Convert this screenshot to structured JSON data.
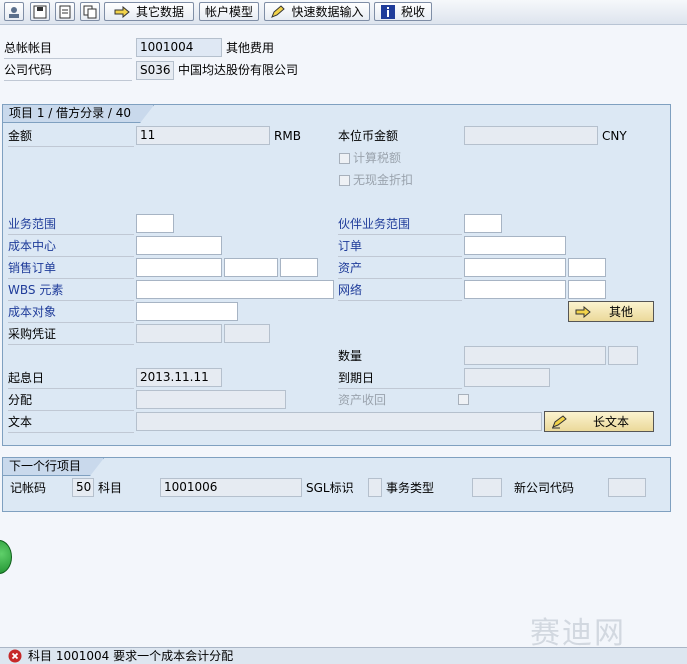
{
  "toolbar": {
    "other_data": "其它数据",
    "account_model": "帐户模型",
    "fast_entry": "快速数据输入",
    "tax": "税收"
  },
  "header": {
    "gl_account_label": "总帐帐目",
    "gl_account_value": "1001004",
    "gl_account_desc": "其他费用",
    "company_code_label": "公司代码",
    "company_code_value": "S036",
    "company_name": "中国均达股份有限公司"
  },
  "item": {
    "title": "项目 1 / 借方分录 / 40",
    "amount_label": "金额",
    "amount_value": "11",
    "currency": "RMB",
    "local_amount_label": "本位币金额",
    "local_currency": "CNY",
    "calc_tax": "计算税额",
    "no_cash_discount": "无现金折扣",
    "business_area": "业务范围",
    "partner_business_area": "伙伴业务范围",
    "cost_center": "成本中心",
    "order": "订单",
    "sales_order": "销售订单",
    "asset": "资产",
    "wbs": "WBS 元素",
    "network": "网络",
    "cost_object": "成本对象",
    "more_button": "其他",
    "purchasing_doc": "采购凭证",
    "quantity": "数量",
    "value_date_label": "起息日",
    "value_date": "2013.11.11",
    "due_date": "到期日",
    "assignment": "分配",
    "asset_retirement": "资产收回",
    "text": "文本",
    "long_text_button": "长文本"
  },
  "next_item": {
    "title": "下一个行项目",
    "posting_key_label": "记帐码",
    "posting_key_value": "50",
    "account_label": "科目",
    "account_value": "1001006",
    "sgl_label": "SGL标识",
    "trans_type_label": "事务类型",
    "new_company_label": "新公司代码"
  },
  "status": {
    "message": "科目 1001004 要求一个成本会计分配"
  },
  "watermark": "赛迪网"
}
